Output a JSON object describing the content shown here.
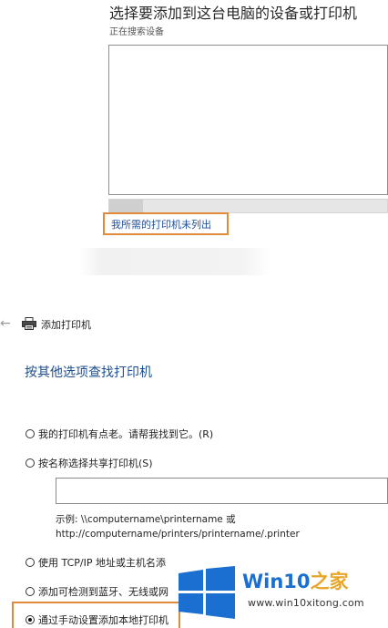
{
  "top_panel": {
    "title": "选择要添加到这台电脑的设备或打印机",
    "status": "正在搜索设备",
    "search_progress": 0.12,
    "not_listed_link": "我所需的打印机未列出"
  },
  "dialog": {
    "back_icon": "back-arrow-icon",
    "printer_icon": "printer-icon",
    "title": "添加打印机",
    "heading": "按其他选项查找打印机",
    "options": {
      "old_printer": "我的打印机有点老。请帮我找到它。(R)",
      "shared_by_name": "按名称选择共享打印机(S)",
      "tcp_ip": "使用 TCP/IP 地址或主机名添",
      "bluetooth": "添加可检测到蓝牙、无线或网",
      "manual_local": "通过手动设置添加本地打印机"
    },
    "selected_option": "manual_local",
    "shared_name_input_value": "",
    "example_line1": "示例: \\\\computername\\printername 或",
    "example_line2": "http://computername/printers/printername/.printer"
  },
  "watermark": {
    "brand_part1": "Win10",
    "brand_part2": "之家",
    "url": "www.win10xitong.com",
    "colors": {
      "blue": "#1a6fd0",
      "gold": "#e8a628"
    }
  },
  "accent_colors": {
    "highlight": "#e08a3c",
    "link": "#1f4e9c",
    "heading": "#1d4f8f"
  }
}
